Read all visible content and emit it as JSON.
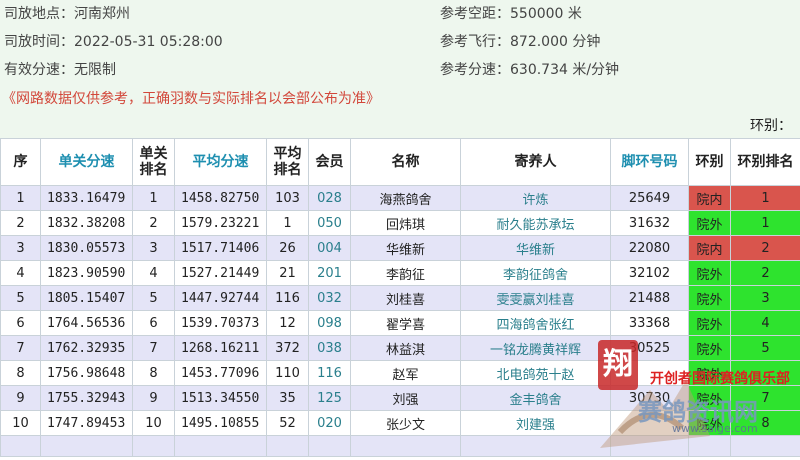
{
  "info": {
    "location": "司放地点：河南郑州",
    "time": "司放时间：2022-05-31 05:28:00",
    "speed_limit": "有效分速：无限制",
    "distance": "参考空距：550000 米",
    "flight": "参考飞行：872.000 分钟",
    "ref_speed": "参考分速：630.734 米/分钟"
  },
  "notice": "《网路数据仅供参考，正确羽数与实际排名以会部公布为准》",
  "group_label": "环别：",
  "headers": [
    "序",
    "单关分速",
    "单关排名",
    "平均分速",
    "平均排名",
    "会员",
    "名称",
    "寄养人",
    "脚环号码",
    "环别",
    "环别排名"
  ],
  "rows": [
    {
      "no": "1",
      "speed": "1833.16479",
      "rank": "1",
      "avg": "1458.82750",
      "avg_rank": "103",
      "member": "028",
      "name": "海燕鸽舍",
      "foster": "许炼",
      "ring": "25649",
      "group": "院内",
      "group_rank": "1"
    },
    {
      "no": "2",
      "speed": "1832.38208",
      "rank": "2",
      "avg": "1579.23221",
      "avg_rank": "1",
      "member": "050",
      "name": "回炜琪",
      "foster": "耐久能苏承坛",
      "ring": "31632",
      "group": "院外",
      "group_rank": "1"
    },
    {
      "no": "3",
      "speed": "1830.05573",
      "rank": "3",
      "avg": "1517.71406",
      "avg_rank": "26",
      "member": "004",
      "name": "华维新",
      "foster": "华维新",
      "ring": "22080",
      "group": "院内",
      "group_rank": "2"
    },
    {
      "no": "4",
      "speed": "1823.90590",
      "rank": "4",
      "avg": "1527.21449",
      "avg_rank": "21",
      "member": "201",
      "name": "李韵征",
      "foster": "李韵征鸽舍",
      "ring": "32102",
      "group": "院外",
      "group_rank": "2"
    },
    {
      "no": "5",
      "speed": "1805.15407",
      "rank": "5",
      "avg": "1447.92744",
      "avg_rank": "116",
      "member": "032",
      "name": "刘桂喜",
      "foster": "雯雯赢刘桂喜",
      "ring": "21488",
      "group": "院外",
      "group_rank": "3"
    },
    {
      "no": "6",
      "speed": "1764.56536",
      "rank": "6",
      "avg": "1539.70373",
      "avg_rank": "12",
      "member": "098",
      "name": "翟学喜",
      "foster": "四海鸽舍张红",
      "ring": "33368",
      "group": "院外",
      "group_rank": "4"
    },
    {
      "no": "7",
      "speed": "1762.32935",
      "rank": "7",
      "avg": "1268.16211",
      "avg_rank": "372",
      "member": "038",
      "name": "林益淇",
      "foster": "一铭龙腾黄祥辉",
      "ring": "30525",
      "group": "院外",
      "group_rank": "5"
    },
    {
      "no": "8",
      "speed": "1756.98648",
      "rank": "8",
      "avg": "1453.77096",
      "avg_rank": "110",
      "member": "116",
      "name": "赵军",
      "foster": "北电鸽苑十赵",
      "ring": "",
      "group": "院外",
      "group_rank": ""
    },
    {
      "no": "9",
      "speed": "1755.32943",
      "rank": "9",
      "avg": "1513.34550",
      "avg_rank": "35",
      "member": "125",
      "name": "刘强",
      "foster": "金丰鸽舍",
      "ring": "30730",
      "group": "院外",
      "group_rank": "7"
    },
    {
      "no": "10",
      "speed": "1747.89453",
      "rank": "10",
      "avg": "1495.10855",
      "avg_rank": "52",
      "member": "020",
      "name": "张少文",
      "foster": "刘建强",
      "ring": "",
      "group": "院外",
      "group_rank": "8"
    }
  ],
  "watermark": {
    "club": "开创者国际赛鸽俱乐部",
    "site": "赛鸽资讯网",
    "url": "www.saige.com",
    "logo_char": "翔"
  },
  "colors": {
    "inner": "#d9554d",
    "outer": "#2ee32e",
    "odd_row": "#e4e4f7",
    "link": "#1e8fb0",
    "notice": "#d2473a"
  }
}
